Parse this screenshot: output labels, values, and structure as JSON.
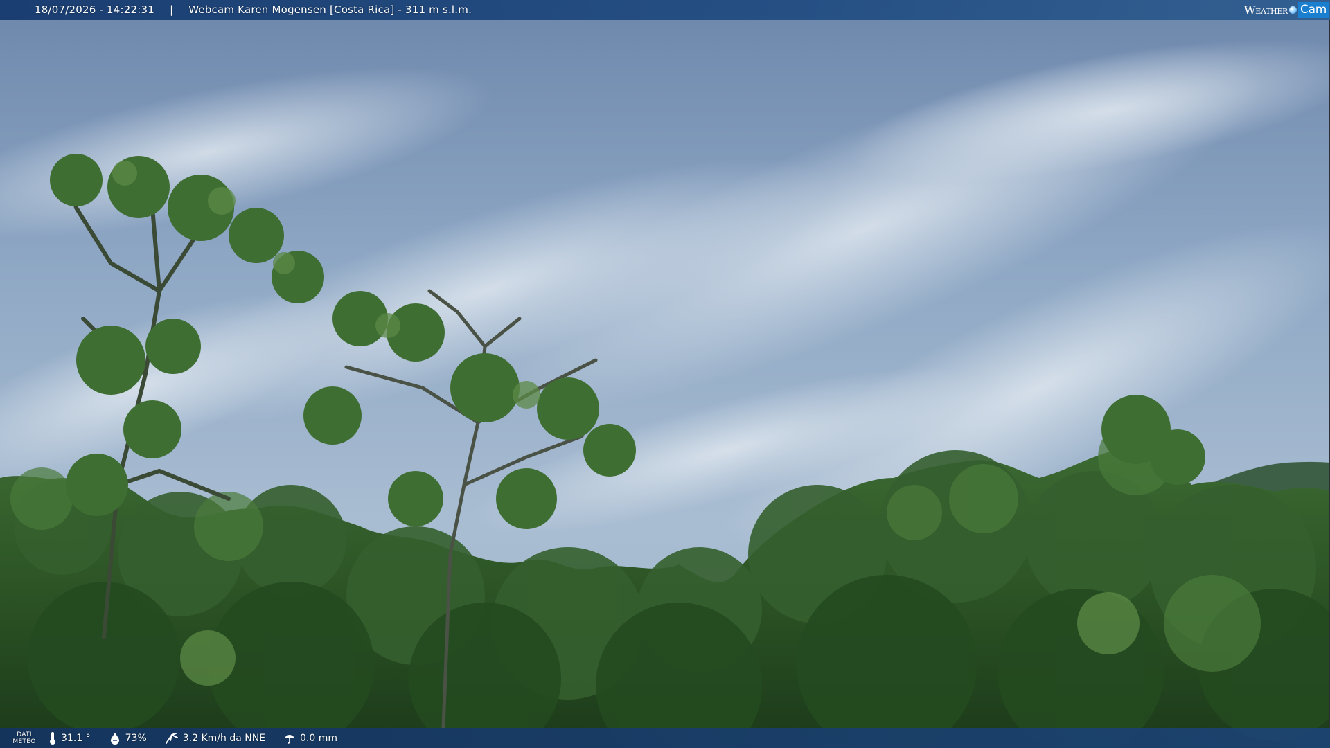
{
  "overlay": {
    "datetime": "18/07/2026 - 14:22:31",
    "separator": "|",
    "title": "Webcam Karen Mogensen [Costa Rica]  - 311 m s.l.m."
  },
  "brand": {
    "part_a": "Weather",
    "part_b": "Cam"
  },
  "meteo": {
    "label_line1": "DATI",
    "label_line2": "METEO",
    "temperature": "31.1 °",
    "humidity": "73%",
    "wind": "3.2 Km/h da NNE",
    "rain": "0.0 mm",
    "icons": [
      "thermometer-icon",
      "humidity-drop-icon",
      "wind-icon",
      "rain-icon"
    ]
  },
  "colors": {
    "bar_blue": "#1e4a80",
    "brand_blue": "#1b7fd0",
    "sky": "#8ea8c6",
    "foliage": "#2f5a2a"
  }
}
